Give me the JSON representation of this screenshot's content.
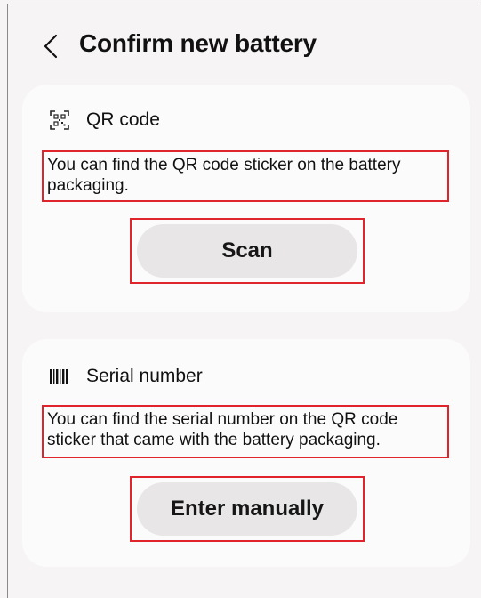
{
  "header": {
    "title": "Confirm new battery",
    "back_icon": "chevron-left-icon"
  },
  "qr_card": {
    "icon": "qr-code-icon",
    "label": "QR code",
    "description": "You can find the QR code sticker on the battery packaging.",
    "button_label": "Scan"
  },
  "serial_card": {
    "icon": "barcode-icon",
    "label": "Serial number",
    "description": "You can find the serial number on the QR code sticker that came with the battery packaging.",
    "button_label": "Enter manually"
  },
  "colors": {
    "background": "#f6f4f4",
    "card": "#fcfbfb",
    "button": "#e8e6e6",
    "highlight_outline": "#e0242b",
    "text": "#111111"
  }
}
